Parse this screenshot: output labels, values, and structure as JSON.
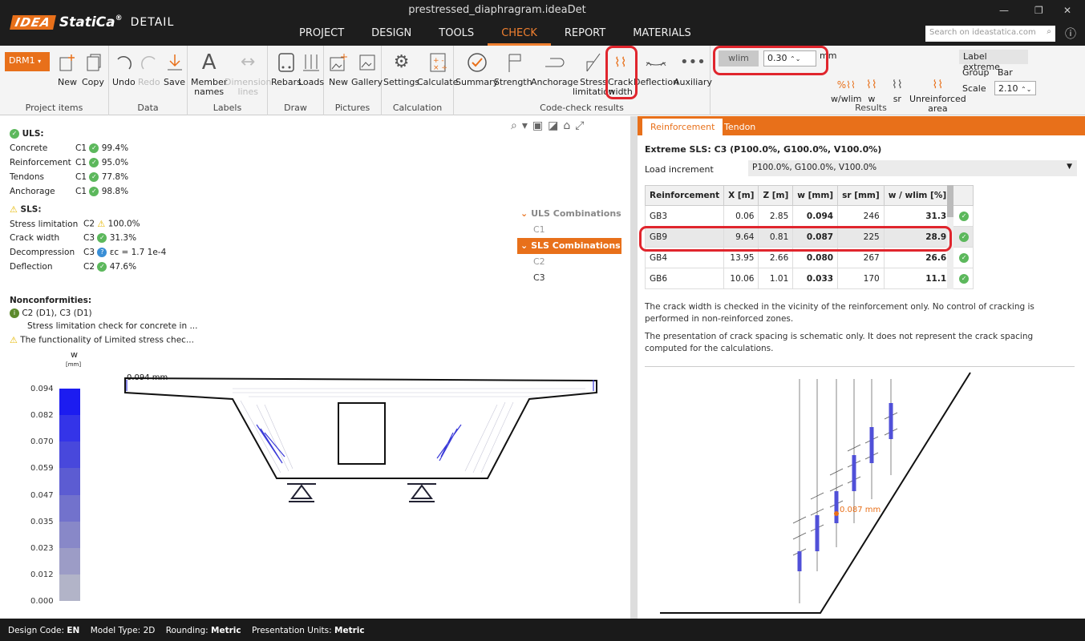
{
  "app": {
    "title": "prestressed_diaphragram.ideaDet",
    "logo_box": "IDEA",
    "brand": "StatiCa",
    "reg": "®",
    "product": "DETAIL"
  },
  "menu": [
    "PROJECT",
    "DESIGN",
    "TOOLS",
    "CHECK",
    "REPORT",
    "MATERIALS"
  ],
  "search_placeholder": "Search on ideastatica.com",
  "ribbon": {
    "drm": "DRM1",
    "new": "New",
    "copy": "Copy",
    "undo": "Undo",
    "redo": "Redo",
    "save": "Save",
    "member": "Member\nnames",
    "dimension": "Dimension\nlines",
    "rebars": "Rebars",
    "loads": "Loads",
    "pic_new": "New",
    "gallery": "Gallery",
    "settings": "Settings",
    "calculate": "Calculate",
    "summary": "Summary",
    "strength": "Strength",
    "anchorage": "Anchorage",
    "stress": "Stress\nlimitation",
    "crack": "Crack\nwidth",
    "deflection": "Deflection",
    "auxiliary": "Auxiliary",
    "wlim_label": "wlim",
    "wlim_value": "0.30",
    "wlim_unit": "mm",
    "w_wlim": "w/wlim",
    "w": "w",
    "sr": "sr",
    "unreinforced": "Unreinforced\narea",
    "label_extreme": "Label extreme",
    "group": "Group",
    "bar": "Bar",
    "scale": "Scale",
    "scale_value": "2.10",
    "groups": [
      "Project items",
      "Data",
      "Labels",
      "Draw",
      "Pictures",
      "Calculation",
      "Code-check results",
      "Results"
    ]
  },
  "summary": {
    "uls_title": "ULS:",
    "uls": [
      {
        "name": "Concrete",
        "comb": "C1",
        "value": "99.4%"
      },
      {
        "name": "Reinforcement",
        "comb": "C1",
        "value": "95.0%"
      },
      {
        "name": "Tendons",
        "comb": "C1",
        "value": "77.8%"
      },
      {
        "name": "Anchorage",
        "comb": "C1",
        "value": "98.8%"
      }
    ],
    "sls_title": "SLS:",
    "sls": [
      {
        "name": "Stress limitation",
        "comb": "C2",
        "value": "100.0%"
      },
      {
        "name": "Crack width",
        "comb": "C3",
        "value": "31.3%"
      },
      {
        "name": "Decompression",
        "comb": "C3",
        "value": "εc = 1.7 1e-4"
      },
      {
        "name": "Deflection",
        "comb": "C2",
        "value": "47.6%"
      }
    ],
    "noncon_title": "Nonconformities:",
    "noncon_1a": "C2 (D1), C3 (D1)",
    "noncon_1b": "Stress limitation check for concrete in ...",
    "noncon_2": "The functionality of Limited stress chec..."
  },
  "tree": {
    "uls_header": "ULS Combinations",
    "uls_items": [
      "C1"
    ],
    "sls_header": "SLS Combinations",
    "sls_items": [
      "C2",
      "C3"
    ]
  },
  "legend": {
    "title": "w",
    "unit": "[mm]",
    "values": [
      "0.094",
      "0.082",
      "0.070",
      "0.059",
      "0.047",
      "0.035",
      "0.023",
      "0.012",
      "0.000"
    ],
    "colors": [
      "#1c1cf0",
      "#3434e8",
      "#4848dc",
      "#5c5cd2",
      "#7272cc",
      "#8888c8",
      "#9c9cc6",
      "#b2b4c8",
      "#c8d0cc"
    ]
  },
  "drawing_label": "0.094 mm",
  "right": {
    "tab_reinf": "Reinforcement",
    "tab_tendon": "Tendon",
    "extreme": "Extreme SLS: C3 (P100.0%, G100.0%, V100.0%)",
    "load_inc_label": "Load increment",
    "load_inc_value": "P100.0%, G100.0%, V100.0%",
    "columns": [
      "Reinforcement",
      "X [m]",
      "Z [m]",
      "w [mm]",
      "sr [mm]",
      "w / wlim [%]",
      ""
    ],
    "rows": [
      [
        "GB3",
        "0.06",
        "2.85",
        "0.094",
        "246",
        "31.3"
      ],
      [
        "GB9",
        "9.64",
        "0.81",
        "0.087",
        "225",
        "28.9"
      ],
      [
        "GB4",
        "13.95",
        "2.66",
        "0.080",
        "267",
        "26.6"
      ],
      [
        "GB6",
        "10.06",
        "1.01",
        "0.033",
        "170",
        "11.1"
      ]
    ],
    "note1": "The crack width is checked in the vicinity of the reinforcement only. No control of cracking is performed in non-reinforced zones.",
    "note2": "The presentation of crack spacing is schematic only. It does not represent the crack spacing computed for the calculations.",
    "detail_label": "0.087 mm"
  },
  "status": {
    "code_label": "Design Code:",
    "code": "EN",
    "model_label": "Model Type:",
    "model": "2D",
    "round_label": "Rounding:",
    "round": "Metric",
    "units_label": "Presentation Units:",
    "units": "Metric"
  }
}
